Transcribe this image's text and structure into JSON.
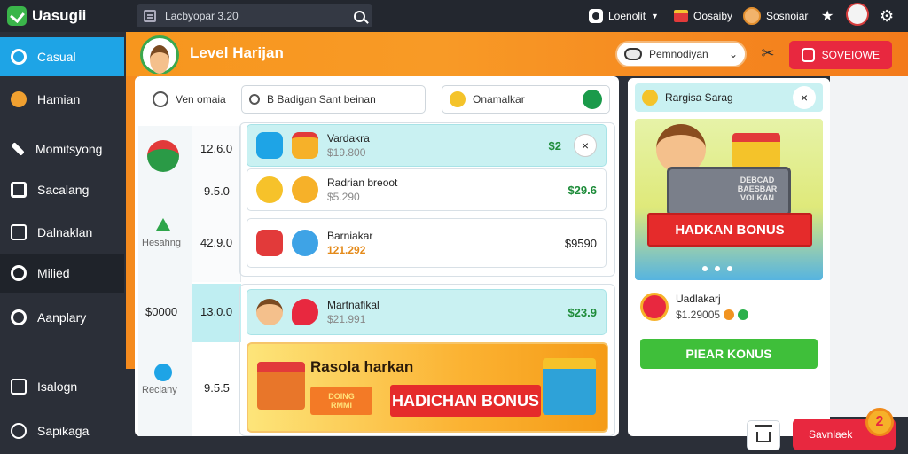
{
  "app": {
    "title": "Uasugii"
  },
  "topbar": {
    "search_text": "Lacbyopar 3.20",
    "user_name": "Loenolit",
    "gift_label": "Oosaiby",
    "profile_label": "Sosnoiar",
    "icons": [
      "document-icon",
      "search-icon",
      "user-icon",
      "gift-icon",
      "face-icon",
      "star-icon",
      "avatar-icon",
      "gear-icon"
    ]
  },
  "sidebar": {
    "items": [
      {
        "label": "Casual",
        "icon": "chat-icon",
        "active": true
      },
      {
        "label": "Hamian",
        "icon": "palette-icon"
      },
      {
        "label": "Momitsyong",
        "icon": "pencil-icon"
      },
      {
        "label": "Sacalang",
        "icon": "mail-icon"
      },
      {
        "label": "Dalnaklan",
        "icon": "screen-icon"
      },
      {
        "label": "Milied",
        "icon": "refresh-icon"
      },
      {
        "label": "Aanplary",
        "icon": "globe-icon"
      },
      {
        "label": "Isalogn",
        "icon": "card-icon"
      },
      {
        "label": "Sapikaga",
        "icon": "help-icon"
      }
    ]
  },
  "header": {
    "title": "Level Harijan",
    "pill_label": "Pemnodiyan",
    "pill_chevron": "⌄",
    "button_label": "SOVEIOWE",
    "colors": {
      "accent": "#f7961e",
      "primary_red": "#e8283f"
    }
  },
  "filters": {
    "left_label": "Ven omaia",
    "search_value": "B Badigan Sant beinan",
    "right_label": "Onamalkar"
  },
  "left_column": {
    "numbers": [
      "12.6.0",
      "9.5.0",
      "42.9.0"
    ],
    "tag_label": "Hesahng",
    "bottom_value": "$0000",
    "bottom_num": "13.0.0",
    "bottom_tag": "Reclany",
    "bottom_num2": "9.5.5"
  },
  "rows": [
    {
      "name": "Vardakra",
      "sub": "$19.800",
      "price": "$2",
      "highlighted": true
    },
    {
      "name": "Radrian breoot",
      "sub": "$5.290",
      "price": "$29.6",
      "highlighted": false
    },
    {
      "name": "Barniakar",
      "sub": "121.292",
      "price": "$9590",
      "highlighted": false
    },
    {
      "name": "Martnafikal",
      "sub": "$21.991",
      "price": "$23.9",
      "highlighted": true
    }
  ],
  "bonus_banner": {
    "title": "Rasola harkan",
    "ribbon": "HADICHAN BONUS",
    "tag_line1": "DOING",
    "tag_line2": "RMMI"
  },
  "right_panel": {
    "title": "Rargisa Sarag",
    "close_icon": "×",
    "image_ribbon": "HADKAN BONUS",
    "chest_text": "DEBCAD BAESBAR VOLKAN",
    "item_name": "Uadlakarj",
    "item_price": "$1.29005",
    "button_label": "PIEAR KONUS"
  },
  "bottom": {
    "save_label": "Savnlaek",
    "badge_value": "2"
  }
}
